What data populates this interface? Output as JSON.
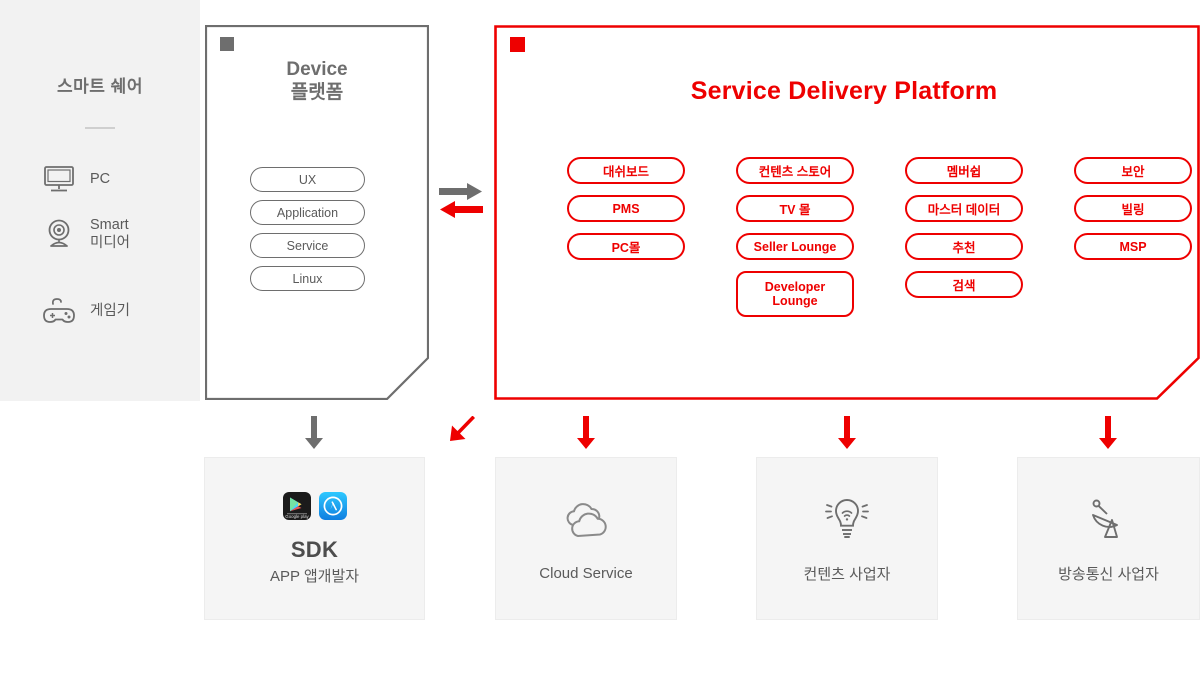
{
  "sidebar": {
    "title": "스마트 쉐어",
    "items": [
      {
        "label": "PC",
        "icon": "monitor-icon"
      },
      {
        "label": "Smart\n미디어",
        "icon": "webcam-icon"
      },
      {
        "label": "게임기",
        "icon": "gamepad-icon"
      }
    ]
  },
  "device_panel": {
    "marker_color": "#6e6e6e",
    "title": "Device\n플랫폼",
    "pills": [
      "UX",
      "Application",
      "Service",
      "Linux"
    ]
  },
  "mid_arrows": {
    "top_arrow": {
      "direction": "right",
      "color": "#6e6e6e",
      "icon": "arrow-right-icon"
    },
    "bottom_arrow": {
      "direction": "left",
      "color": "#ee0000",
      "icon": "arrow-left-icon"
    }
  },
  "platform_panel": {
    "marker_color": "#ee0000",
    "title": "Service Delivery Platform",
    "accent_color": "#ee0000",
    "columns": [
      {
        "items": [
          "대쉬보드",
          "PMS",
          "PC몰"
        ]
      },
      {
        "items": [
          "컨텐츠 스토어",
          "TV 몰",
          "Seller Lounge",
          "Developer\nLounge"
        ]
      },
      {
        "items": [
          "멤버쉽",
          "마스터 데이터",
          "추천",
          "검색"
        ]
      },
      {
        "items": [
          "보안",
          "빌링",
          "MSP"
        ]
      }
    ]
  },
  "arrows": [
    {
      "name": "arrow-to-sdk",
      "color": "#6e6e6e",
      "direction": "down"
    },
    {
      "name": "arrow-to-device",
      "color": "#ee0000",
      "direction": "down-left"
    },
    {
      "name": "arrow-to-cloud",
      "color": "#ee0000",
      "direction": "down"
    },
    {
      "name": "arrow-to-contents",
      "color": "#ee0000",
      "direction": "down"
    },
    {
      "name": "arrow-to-broadcast",
      "color": "#ee0000",
      "direction": "down"
    }
  ],
  "cards": [
    {
      "id": "sdk",
      "title": "SDK",
      "subtitle": "APP 앱개발자",
      "icons": [
        "google-play-icon",
        "app-store-icon"
      ]
    },
    {
      "id": "cloud",
      "label": "Cloud Service",
      "icon": "cloud-icon"
    },
    {
      "id": "contents",
      "label": "컨텐츠 사업자",
      "icon": "lightbulb-wifi-icon"
    },
    {
      "id": "broadcast",
      "label": "방송통신 사업자",
      "icon": "satellite-dish-icon"
    }
  ]
}
